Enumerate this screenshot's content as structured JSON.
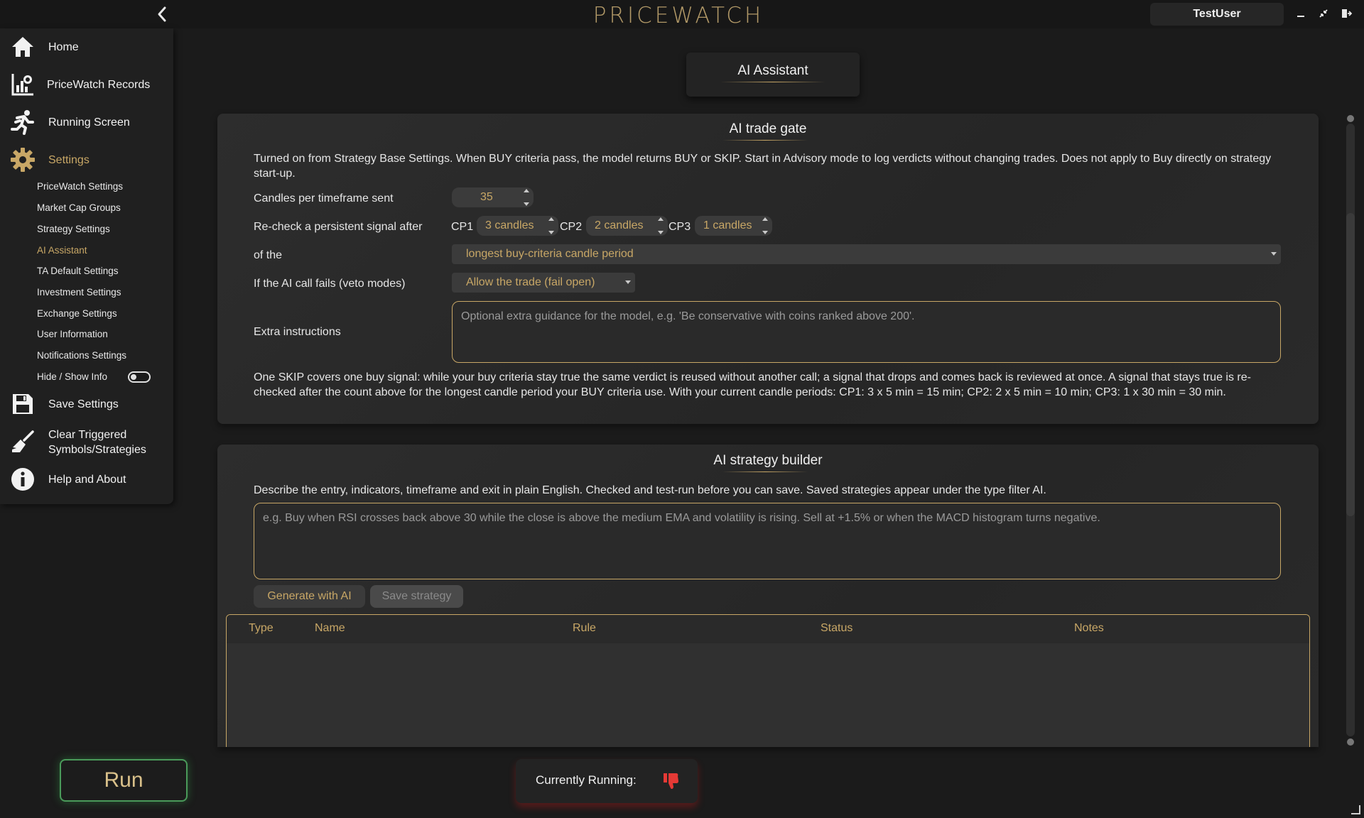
{
  "app": {
    "title": "PRICEWATCH",
    "user": "TestUser"
  },
  "sidebar": {
    "items": [
      {
        "label": "Home",
        "icon": "home-icon"
      },
      {
        "label": "PriceWatch Records",
        "icon": "records-icon"
      },
      {
        "label": "Running Screen",
        "icon": "running-icon"
      },
      {
        "label": "Settings",
        "icon": "gear-icon"
      },
      {
        "label": "Save Settings",
        "icon": "save-icon"
      },
      {
        "label": "Clear Triggered\nSymbols/Strategies",
        "icon": "broom-icon"
      },
      {
        "label": "Help and About",
        "icon": "info-icon"
      }
    ],
    "settings_sub": [
      "PriceWatch Settings",
      "Market Cap Groups",
      "Strategy Settings",
      "AI Assistant",
      "TA Default Settings",
      "Investment Settings",
      "Exchange Settings",
      "User Information",
      "Notifications Settings"
    ],
    "active_sub": "AI Assistant",
    "hide_show_label": "Hide / Show Info",
    "hide_show_on": false
  },
  "page": {
    "title": "AI Assistant"
  },
  "trade_gate": {
    "title": "AI trade gate",
    "description": "Turned on from Strategy Base Settings. When BUY criteria pass, the model returns BUY or SKIP. Start in Advisory mode to log verdicts without changing trades. Does not apply to Buy directly on strategy start-up.",
    "candles_label": "Candles per timeframe sent",
    "candles_value": "35",
    "recheck_label": "Re-check a persistent signal after",
    "cp1_label": "CP1",
    "cp1_value": "3 candles",
    "cp2_label": "CP2",
    "cp2_value": "2 candles",
    "cp3_label": "CP3",
    "cp3_value": "1 candles",
    "of_the_label": "of the",
    "period_value": "longest buy-criteria candle period",
    "fail_label": "If the AI call fails (veto modes)",
    "fail_value": "Allow the trade (fail open)",
    "extra_label": "Extra instructions",
    "extra_placeholder": "Optional extra guidance for the model, e.g. 'Be conservative with coins ranked above 200'.",
    "note": "One SKIP covers one buy signal: while your buy criteria stay true the same verdict is reused without another call; a signal that drops and comes back is reviewed at once. A signal that stays true is re-checked after the count above for the longest candle period your BUY criteria use. With your current candle periods: CP1: 3 x 5 min = 15 min;  CP2: 2 x 5 min = 10 min; CP3: 1 x 30 min = 30 min."
  },
  "strategy_builder": {
    "title": "AI strategy builder",
    "description": "Describe the entry, indicators, timeframe and exit in plain English. Checked and test-run before you can save. Saved strategies appear under the type filter AI.",
    "placeholder": "e.g. Buy when RSI crosses back above 30 while the close is above the medium EMA and volatility is rising. Sell at +1.5% or when the MACD histogram turns negative.",
    "generate_label": "Generate with AI",
    "save_label": "Save strategy",
    "columns": [
      "Type",
      "Name",
      "Rule",
      "Status",
      "Notes"
    ],
    "rows": []
  },
  "bottom": {
    "run_label": "Run",
    "running_label": "Currently Running:",
    "running_icon": "thumbs-down-icon"
  },
  "colors": {
    "accent": "#c8a766",
    "background": "#1b1b1b",
    "panel": "#2a2a2a",
    "run_border": "#4a9a5a",
    "status_red": "#e53935"
  }
}
